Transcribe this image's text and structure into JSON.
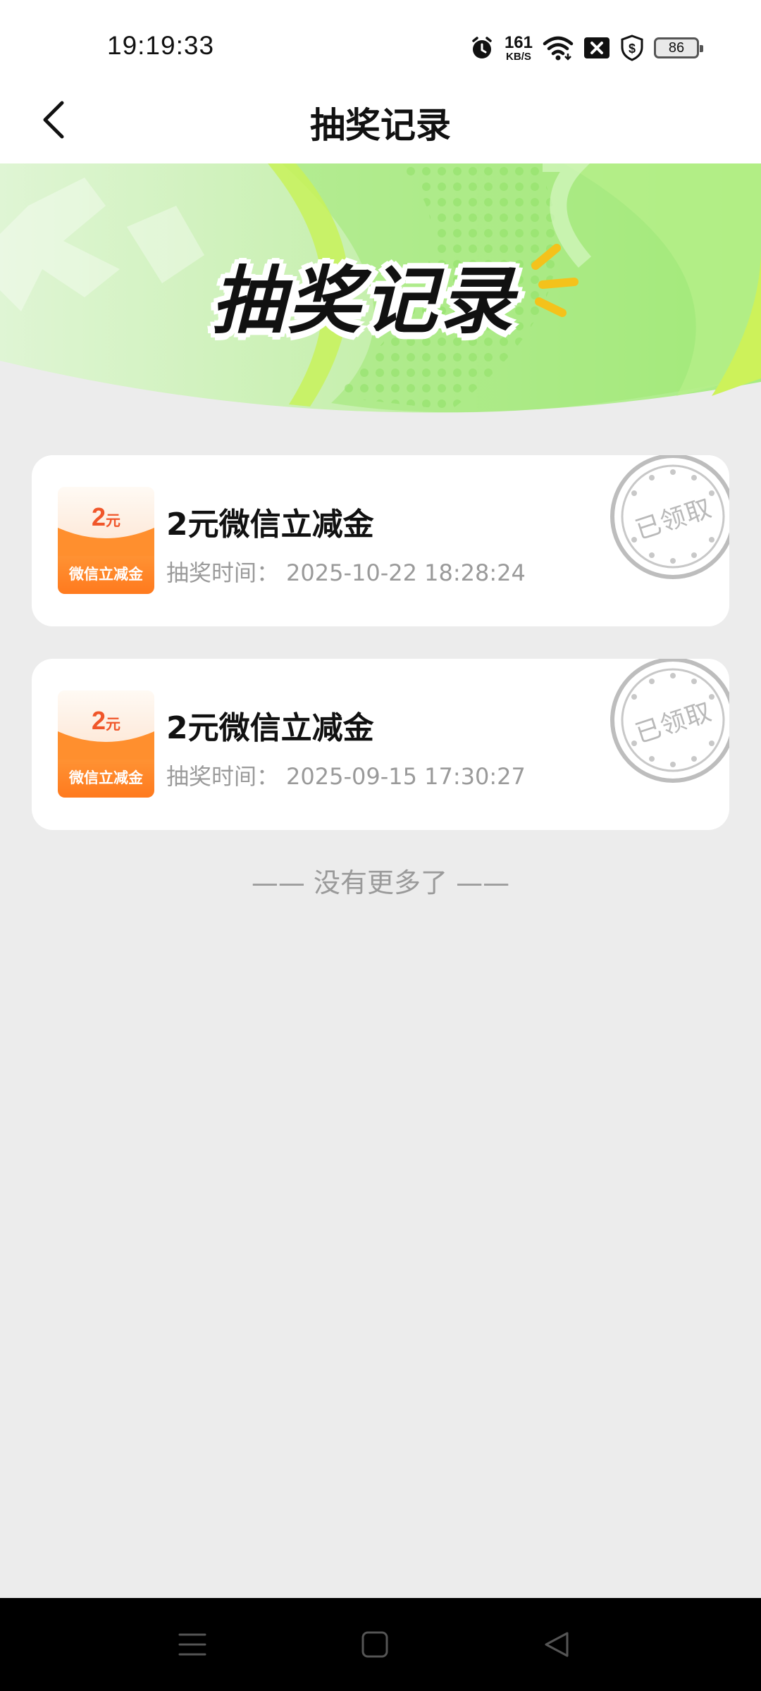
{
  "status_bar": {
    "time": "19:19:33",
    "net_speed": "161",
    "net_unit": "KB/S",
    "battery": "86",
    "icons": [
      "alarm-icon",
      "wifi-icon",
      "notification-close-icon",
      "shield-dollar-icon",
      "battery-icon"
    ]
  },
  "header": {
    "title": "抽奖记录",
    "back_icon": "chevron-left-icon"
  },
  "banner": {
    "title": "抽奖记录",
    "colors": {
      "light_green": "#c9f2b4",
      "green": "#8ee66d",
      "lime": "#c8f25a",
      "accent_yellow": "#f4c21b"
    }
  },
  "records": [
    {
      "thumb_amount": "2",
      "thumb_unit": "元",
      "thumb_label": "微信立减金",
      "name": "2元微信立减金",
      "time_label": "抽奖时间：",
      "time_value": "2025-10-22 18:28:24",
      "status": "已领取"
    },
    {
      "thumb_amount": "2",
      "thumb_unit": "元",
      "thumb_label": "微信立减金",
      "name": "2元微信立减金",
      "time_label": "抽奖时间：",
      "time_value": "2025-09-15 17:30:27",
      "status": "已领取"
    }
  ],
  "list_footer": "—— 没有更多了 ——",
  "system_nav": {
    "icons": [
      "menu-icon",
      "home-square-icon",
      "back-triangle-icon"
    ]
  }
}
